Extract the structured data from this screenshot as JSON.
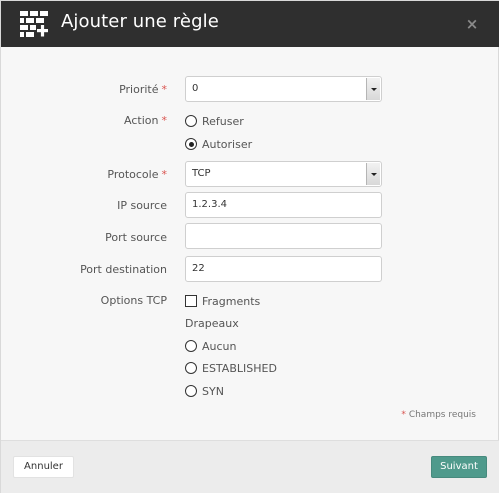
{
  "header": {
    "title": "Ajouter une règle",
    "icon": "firewall-add-icon",
    "close_symbol": "×"
  },
  "form": {
    "priority": {
      "label": "Priorité",
      "value": "0"
    },
    "action": {
      "label": "Action",
      "options": [
        "Refuser",
        "Autoriser"
      ],
      "selected": "Autoriser"
    },
    "protocol": {
      "label": "Protocole",
      "value": "TCP"
    },
    "ip_source": {
      "label": "IP source",
      "value": "1.2.3.4"
    },
    "port_source": {
      "label": "Port source",
      "value": ""
    },
    "port_destination": {
      "label": "Port destination",
      "value": "22"
    },
    "tcp_options": {
      "label": "Options TCP",
      "fragments_label": "Fragments",
      "fragments_checked": false,
      "flags_label": "Drapeaux",
      "flags": [
        "Aucun",
        "ESTABLISHED",
        "SYN"
      ],
      "flags_selected": null
    },
    "required_marker": "*",
    "required_note": "Champs requis"
  },
  "footer": {
    "cancel_label": "Annuler",
    "next_label": "Suivant"
  },
  "colors": {
    "header_bg": "#2f2f2f",
    "required": "#d9534f",
    "primary_button": "#4f9a8c"
  }
}
